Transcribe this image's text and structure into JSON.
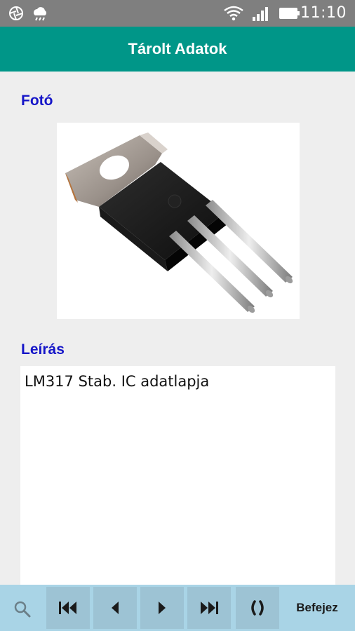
{
  "status_bar": {
    "time": "11:10",
    "left_icons": [
      "aperture-icon",
      "weather-icon"
    ],
    "right_icons": [
      "wifi-icon",
      "signal-icon",
      "battery-icon"
    ]
  },
  "header": {
    "title": "Tárolt Adatok",
    "color": "#009688"
  },
  "photo": {
    "label": "Fotó",
    "image_alt": "TO-220 voltage regulator component"
  },
  "description": {
    "label": "Leírás",
    "value": "LM317 Stab. IC adatlapja"
  },
  "toolbar": {
    "search_icon": "search-icon",
    "buttons": [
      "first-record-icon",
      "previous-record-icon",
      "next-record-icon",
      "last-record-icon",
      "refresh-icon"
    ],
    "finish_label": "Befejez"
  },
  "colors": {
    "label_blue": "#1515c8",
    "toolbar_bg": "#a9d4e6"
  }
}
